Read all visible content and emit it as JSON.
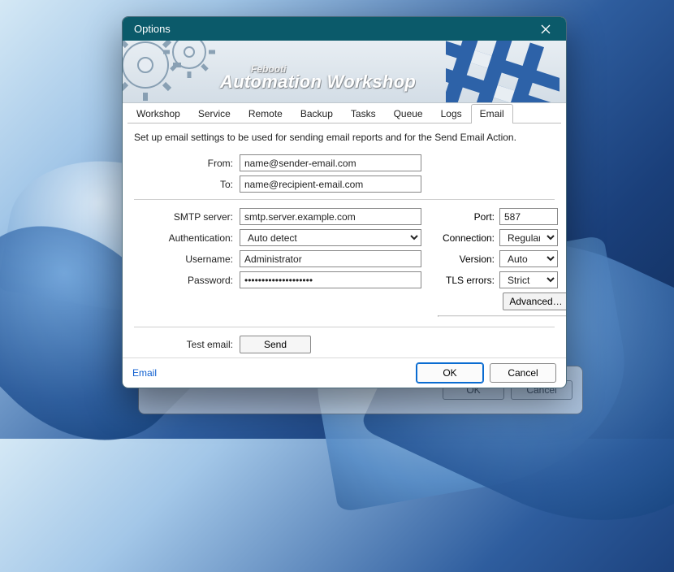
{
  "window": {
    "title": "Options"
  },
  "banner": {
    "company": "Febooti",
    "product": "Automation Workshop"
  },
  "tabs": {
    "items": [
      {
        "label": "Workshop"
      },
      {
        "label": "Service"
      },
      {
        "label": "Remote"
      },
      {
        "label": "Backup"
      },
      {
        "label": "Tasks"
      },
      {
        "label": "Queue"
      },
      {
        "label": "Logs"
      },
      {
        "label": "Email"
      }
    ],
    "active_index": 7
  },
  "description": "Set up email settings to be used for sending email reports and for the Send Email Action.",
  "fields": {
    "from_label": "From:",
    "from_value": "name@sender-email.com",
    "to_label": "To:",
    "to_value": "name@recipient-email.com",
    "smtp_label": "SMTP server:",
    "smtp_value": "smtp.server.example.com",
    "auth_label": "Authentication:",
    "auth_value": "Auto detect",
    "user_label": "Username:",
    "user_value": "Administrator",
    "pass_label": "Password:",
    "pass_value": "••••••••••••••••••••",
    "port_label": "Port:",
    "port_value": "587",
    "conn_label": "Connection:",
    "conn_value": "Regular",
    "version_label": "Version:",
    "version_value": "Auto",
    "tls_label": "TLS errors:",
    "tls_value": "Strict",
    "advanced_label": "Advanced…",
    "test_label": "Test email:",
    "send_label": "Send"
  },
  "footer": {
    "link": "Email",
    "ok": "OK",
    "cancel": "Cancel"
  }
}
